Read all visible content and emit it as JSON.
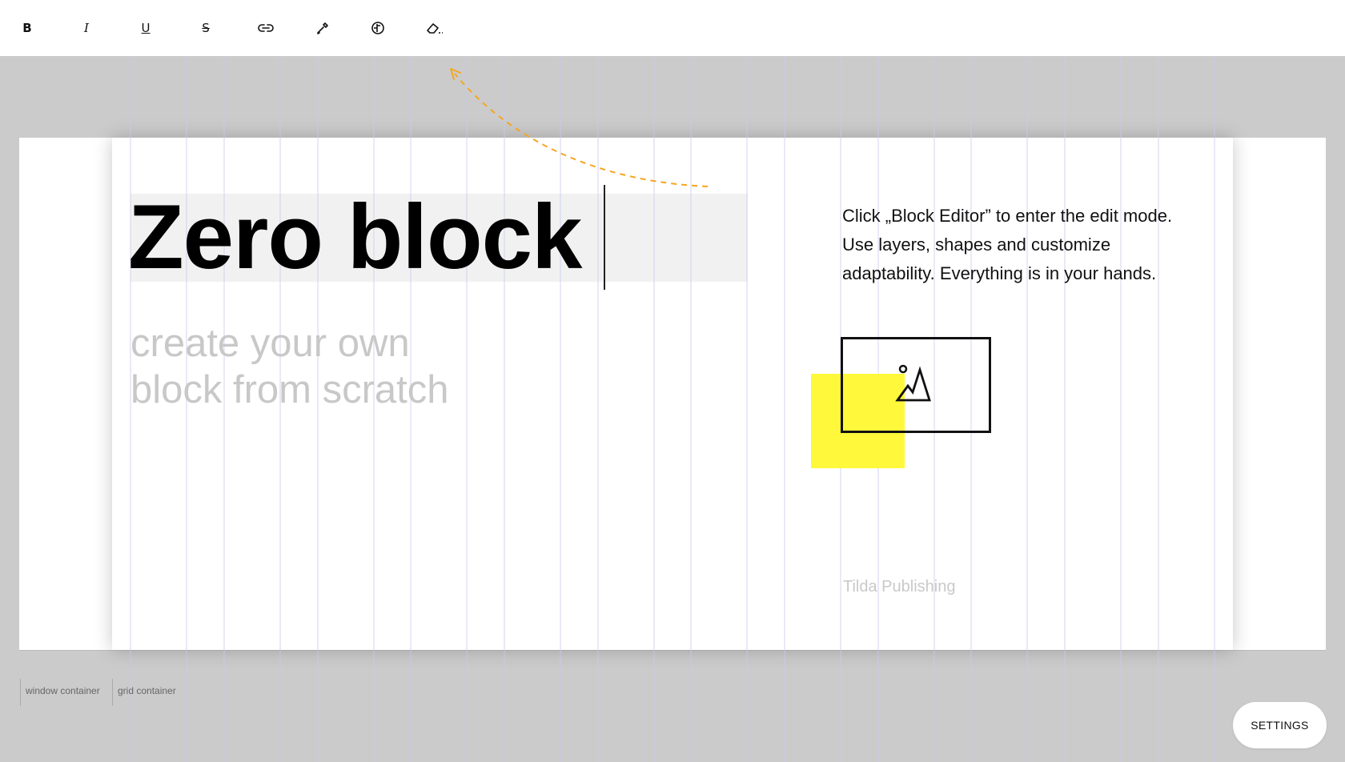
{
  "toolbar": {
    "tools": [
      {
        "name": "bold",
        "label": "B",
        "icon": "bold-icon"
      },
      {
        "name": "italic",
        "label": "I",
        "icon": "italic-icon"
      },
      {
        "name": "underline",
        "label": "U",
        "icon": "underline-icon"
      },
      {
        "name": "strikethrough",
        "label": "S",
        "icon": "strikethrough-icon"
      },
      {
        "name": "link",
        "icon": "link-icon"
      },
      {
        "name": "color",
        "icon": "pipette-icon"
      },
      {
        "name": "typography",
        "icon": "font-icon"
      },
      {
        "name": "clear-format",
        "icon": "eraser-icon"
      }
    ]
  },
  "canvas": {
    "title": "Zero block",
    "subtitle": [
      "create your own",
      "block from scratch"
    ],
    "description": [
      "Click „Block Editor” to enter the edit mode.",
      "Use layers, shapes and customize",
      "adaptability. Everything is in your hands."
    ],
    "brand": "Tilda Publishing",
    "image_placeholder_icon": "image-icon"
  },
  "footer": {
    "window_container_label": "window container",
    "grid_container_label": "grid container",
    "settings_label": "SETTINGS"
  },
  "colors": {
    "accent_yellow": "#fff83b",
    "arrow_orange": "#f5a623",
    "workspace_gray": "#cbcbcb",
    "grid_line": "#c9cbee"
  }
}
